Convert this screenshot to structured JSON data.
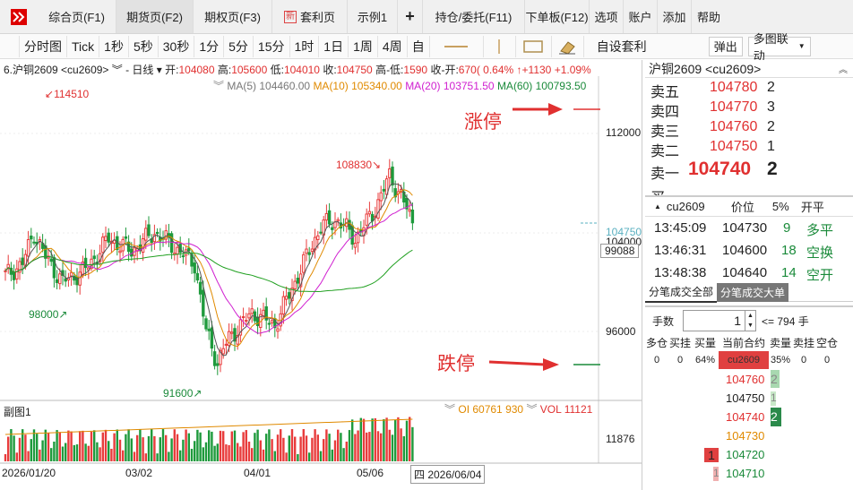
{
  "menubar": {
    "tabs": [
      "综合页(F1)",
      "期货页(F2)",
      "期权页(F3)",
      "套利页",
      "示例1",
      "+",
      "持仓/委托(F11)",
      "下单板(F12)",
      "选项",
      "账户",
      "添加",
      "帮助"
    ],
    "new_badge": "新"
  },
  "toolbar": {
    "items": [
      "分时图",
      "Tick",
      "1秒",
      "5秒",
      "30秒",
      "1分",
      "5分",
      "15分",
      "1时",
      "1日",
      "1周",
      "4周",
      "自"
    ],
    "custom": "自设套利",
    "popup": "弹出",
    "multi": "多图联动"
  },
  "chart": {
    "header": "6.沪铜2609 <cu2609> ︾ - 日线 ▾",
    "open_label": "开:",
    "open": "104080",
    "high_label": "高:",
    "high": "105600",
    "low_label": "低:",
    "low": "104010",
    "close_label": "收:",
    "close": "104750",
    "hl_label": "高-低:",
    "hl": "1590",
    "oc_label": "收-开:",
    "oc": "670( 0.64%",
    "chg": "↑+1130",
    "chg_pct": "+1.09%",
    "ma": {
      "ma5": "MA(5) 104460.00",
      "ma10": "MA(10) 105340.00",
      "ma20": "MA(20) 103751.50",
      "ma60": "MA(60) 100793.50"
    },
    "price_labels": {
      "p112": "112000",
      "p104": "104000",
      "p99": "99088",
      "p96": "96000",
      "p11876": "11876",
      "cur": "104750"
    },
    "annotations": {
      "top": "114510",
      "peak2": "108830",
      "low1": "98000",
      "low2": "91600",
      "limit_up": "涨停",
      "limit_down": "跌停"
    },
    "sub": {
      "title": "副图1",
      "oi": "OI 60761 930",
      "vol": "VOL 11121"
    },
    "dates": [
      "2026/01/20",
      "03/02",
      "04/01",
      "05/06"
    ],
    "date_cursor": "四 2026/06/04",
    "colors": {
      "up": "#e83c3c",
      "down": "#1e9a3c",
      "ma5": "#555555",
      "ma10": "#e08a00",
      "ma20": "#d020d0",
      "ma60": "#20a020"
    }
  },
  "orderbook": {
    "title": "沪铜2609 <cu2609>",
    "asks": [
      {
        "label": "卖五",
        "price": "104780",
        "vol": "2"
      },
      {
        "label": "卖四",
        "price": "104770",
        "vol": "3"
      },
      {
        "label": "卖三",
        "price": "104760",
        "vol": "2"
      },
      {
        "label": "卖二",
        "price": "104750",
        "vol": "1"
      },
      {
        "label": "卖一",
        "price": "104740",
        "vol": "2"
      }
    ],
    "partial": "买一"
  },
  "trades": {
    "header": [
      "cu2609",
      "价位",
      "5%",
      "开平"
    ],
    "rows": [
      {
        "time": "13:45:09",
        "price": "104730",
        "vol": "9",
        "type": "多平"
      },
      {
        "time": "13:46:31",
        "price": "104600",
        "vol": "18",
        "type": "空换"
      },
      {
        "time": "13:48:38",
        "price": "104640",
        "vol": "14",
        "type": "空开"
      }
    ],
    "tab1": "分笔成交全部",
    "tab2": "分笔成交大单"
  },
  "order": {
    "qty_label": "手数",
    "qty": "1",
    "max": "<= 794 手",
    "cols": [
      "多仓",
      "买挂",
      "买量",
      "当前合约",
      "卖量",
      "卖挂",
      "空仓"
    ],
    "vals": [
      "0",
      "0",
      "64%",
      "cu2609",
      "35%",
      "0",
      "0"
    ],
    "ladder": [
      {
        "price": "104760",
        "sell": "2"
      },
      {
        "price": "104750",
        "sell": "1"
      },
      {
        "price": "104740",
        "sell": "2"
      },
      {
        "price": "104730",
        "sell": ""
      },
      {
        "price": "104720",
        "buy": "1"
      },
      {
        "price": "104710",
        "buy": "1"
      }
    ]
  }
}
